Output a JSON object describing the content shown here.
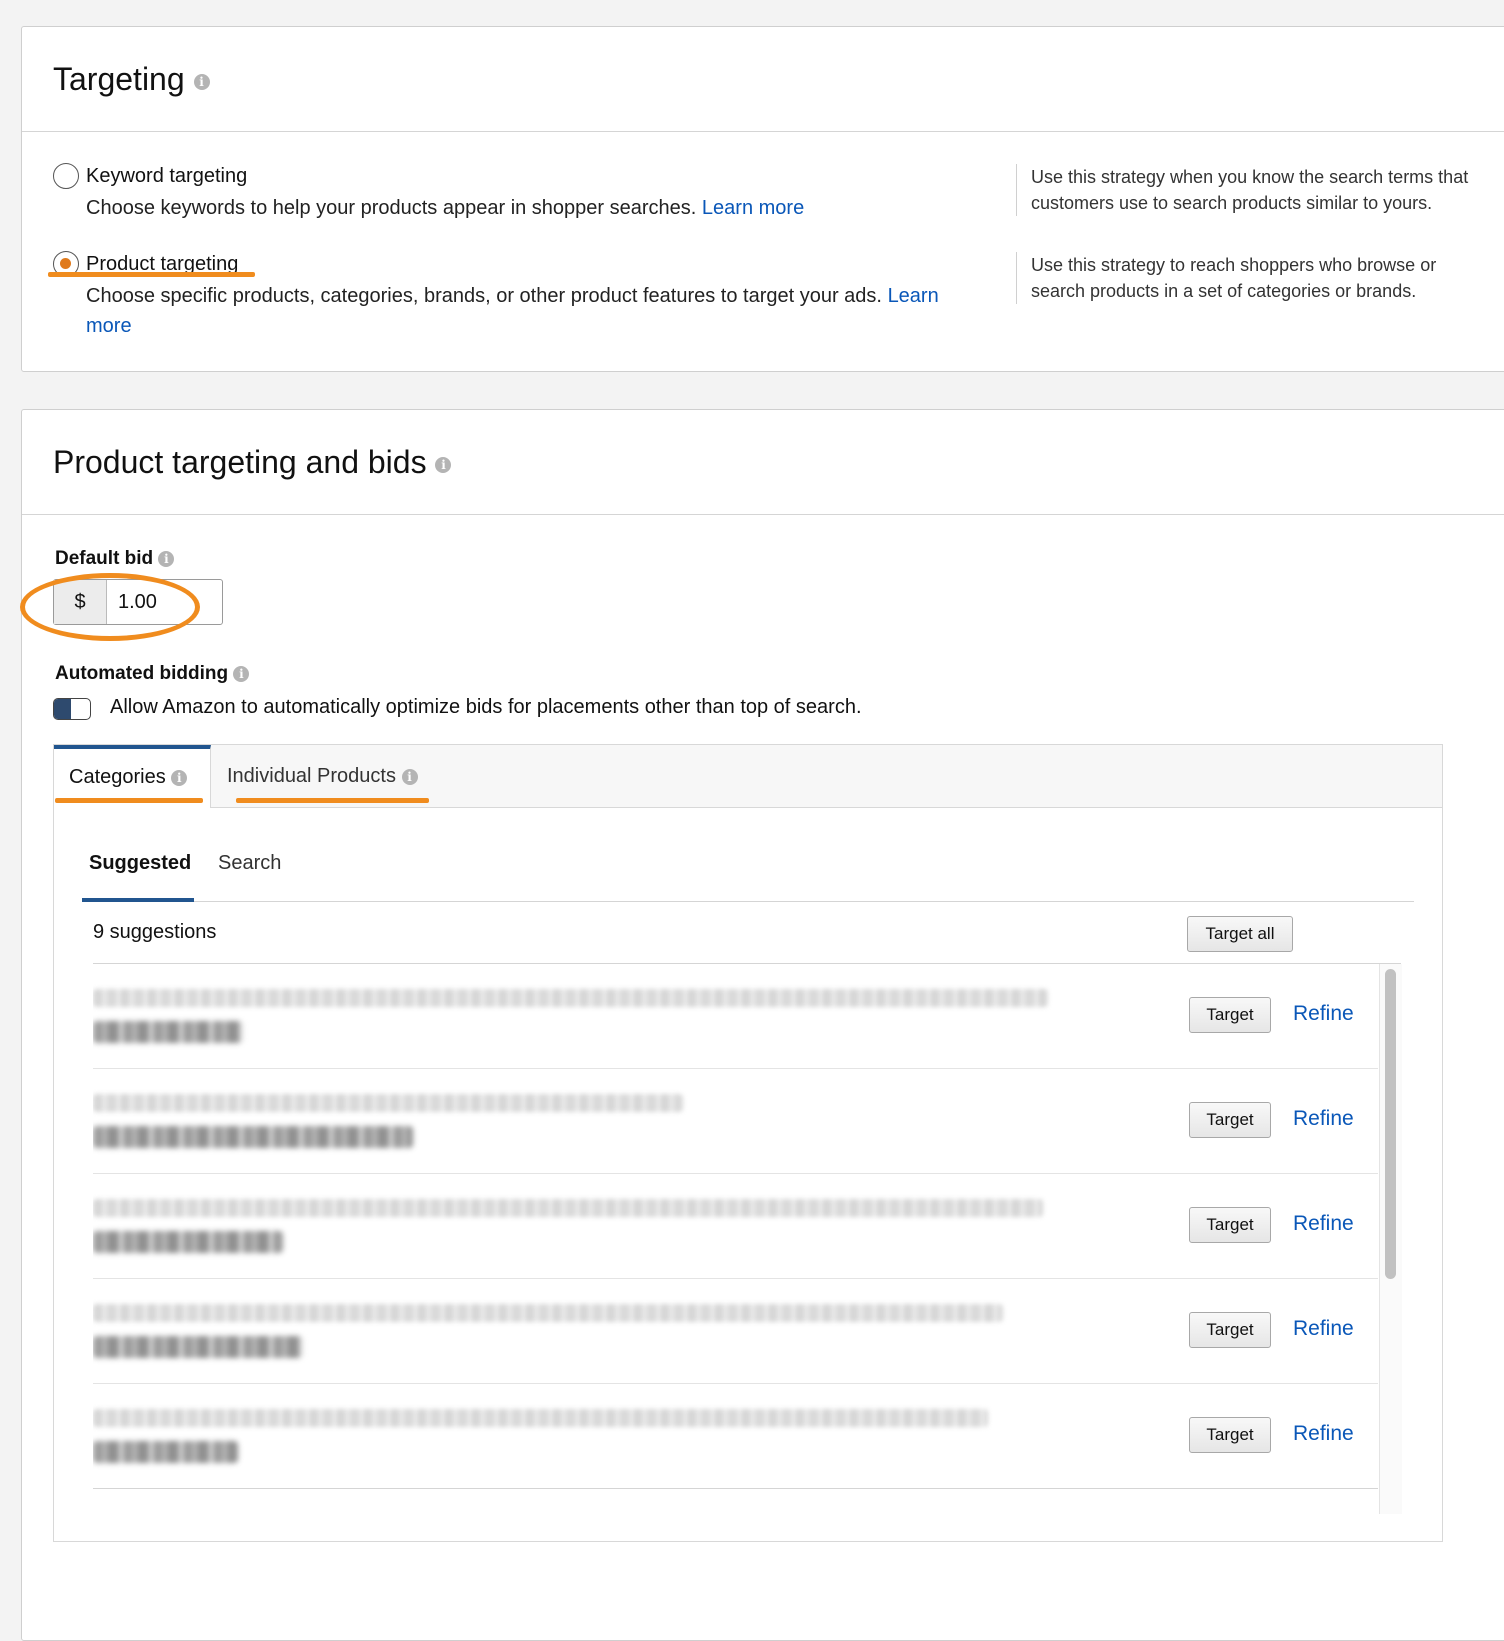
{
  "targeting": {
    "title": "Targeting",
    "info_icon": "info-icon",
    "options": [
      {
        "label": "Keyword targeting",
        "selected": false,
        "description": "Choose keywords to help your products appear in shopper searches.",
        "learn_more": "Learn more",
        "note": "Use this strategy when you know the search terms that customers use to search products similar to yours."
      },
      {
        "label": "Product targeting",
        "selected": true,
        "description": "Choose specific products, categories, brands, or other product features to target your ads.",
        "learn_more": "Learn more",
        "note": "Use this strategy to reach shoppers who browse or search products in a set of categories or brands."
      }
    ]
  },
  "bids": {
    "title": "Product targeting and bids",
    "default_bid": {
      "label": "Default bid",
      "currency": "$",
      "value": "1.00"
    },
    "automated_bidding": {
      "label": "Automated bidding",
      "toggle_text": "Allow Amazon to automatically optimize bids for placements other than top of search.",
      "enabled": true
    },
    "tabs": [
      {
        "label": "Categories",
        "active": true
      },
      {
        "label": "Individual Products",
        "active": false
      }
    ],
    "subtabs": [
      {
        "label": "Suggested",
        "active": true
      },
      {
        "label": "Search",
        "active": false
      }
    ],
    "suggestion_count": "9 suggestions",
    "target_all_label": "Target all",
    "row_target_label": "Target",
    "row_refine_label": "Refine"
  },
  "colors": {
    "accent_orange": "#f08c1e",
    "link_blue": "#0a57b8",
    "tab_active": "#21558f"
  }
}
